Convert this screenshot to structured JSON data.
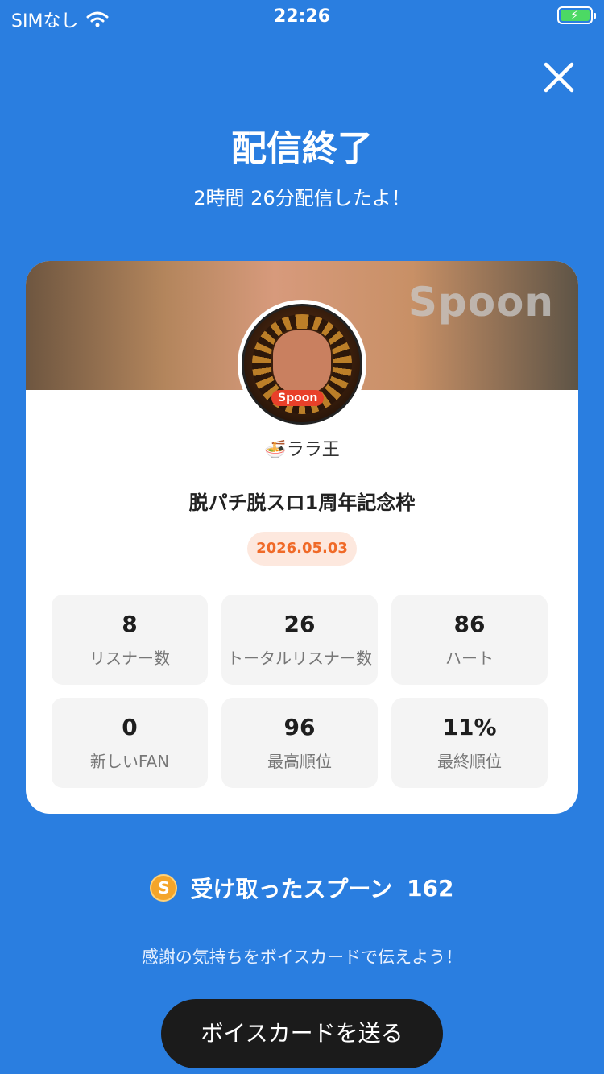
{
  "status_bar": {
    "carrier": "SIMなし",
    "time": "22:26"
  },
  "header": {
    "title": "配信終了",
    "subtitle": "2時間 26分配信したよ！"
  },
  "card": {
    "brand": "Spoon",
    "avatar_tag": "Spoon",
    "dj_name": "ララ王",
    "live_title": "脱パチ脱スロ1周年記念枠",
    "date": "2026.05.03",
    "stats": [
      {
        "value": "8",
        "label": "リスナー数"
      },
      {
        "value": "26",
        "label": "トータルリスナー数"
      },
      {
        "value": "86",
        "label": "ハート"
      },
      {
        "value": "0",
        "label": "新しいFAN"
      },
      {
        "value": "96",
        "label": "最高順位"
      },
      {
        "value": "11%",
        "label": "最終順位"
      }
    ]
  },
  "spoons": {
    "coin_symbol": "S",
    "label": "受け取ったスプーン",
    "count": "162"
  },
  "thanks_text": "感謝の気持ちをボイスカードで伝えよう！",
  "voicecard_button": "ボイスカードを送る",
  "icons": {
    "wifi": "wifi-icon",
    "battery": "battery-charging-icon",
    "close": "close-icon",
    "coin": "spoon-coin-icon"
  },
  "colors": {
    "background": "#2a7ee0",
    "date_accent": "#f06a28",
    "button": "#1b1b1b"
  }
}
